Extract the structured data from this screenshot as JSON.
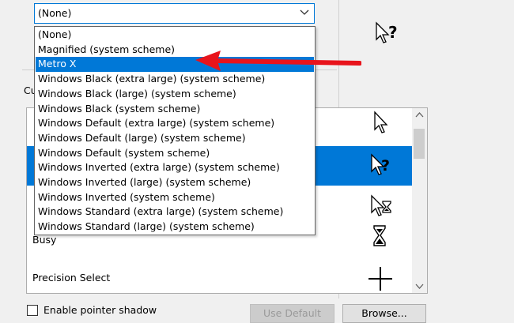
{
  "scheme": {
    "selected": "(None)",
    "options": [
      "(None)",
      "Magnified (system scheme)",
      "Metro X",
      "Windows Black (extra large) (system scheme)",
      "Windows Black (large) (system scheme)",
      "Windows Black (system scheme)",
      "Windows Default (extra large) (system scheme)",
      "Windows Default (large) (system scheme)",
      "Windows Default (system scheme)",
      "Windows Inverted (extra large) (system scheme)",
      "Windows Inverted (large) (system scheme)",
      "Windows Inverted (system scheme)",
      "Windows Standard (extra large) (system scheme)",
      "Windows Standard (large) (system scheme)"
    ],
    "highlighted": "Metro X"
  },
  "customize": {
    "label_visible": "Cu",
    "rows": [
      {
        "label": "Busy"
      },
      {
        "label": "Precision Select"
      }
    ]
  },
  "bottom": {
    "shadow_label": "Enable pointer shadow",
    "use_default_label": "Use Default",
    "browse_label": "Browse..."
  },
  "colors": {
    "accent": "#0078d7",
    "arrow": "#e8141c"
  }
}
